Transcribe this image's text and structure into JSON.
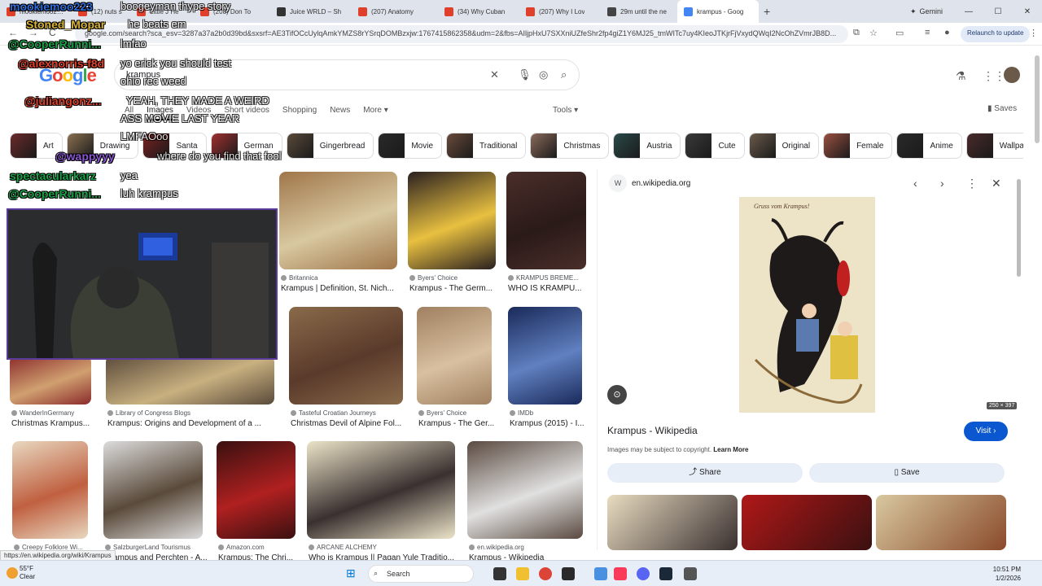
{
  "tabs": [
    {
      "title": "mookiemoo223 boogeyman thype story",
      "color": "#e0402a",
      "active": false,
      "w": 88
    },
    {
      "title": "(12) nuts s",
      "color": "#e0402a",
      "active": false,
      "w": 72
    },
    {
      "title": "Little J He",
      "color": "#e0402a",
      "active": false,
      "w": 78
    },
    {
      "title": "(208) Don To",
      "color": "#e0402a",
      "active": false,
      "w": 94
    },
    {
      "title": "Juice WRLD – Sh",
      "color": "#333333",
      "active": false,
      "w": 100
    },
    {
      "title": "(207) Anatomy",
      "color": "#e0402a",
      "active": false,
      "w": 106
    },
    {
      "title": "(34) Why Cuban",
      "color": "#e0402a",
      "active": false,
      "w": 100
    },
    {
      "title": "(207) Why I Lov",
      "color": "#e0402a",
      "active": false,
      "w": 100
    },
    {
      "title": "29m until the ne",
      "color": "#444444",
      "active": false,
      "w": 94
    },
    {
      "title": "krampus - Goog",
      "color": "#4285f4",
      "active": true,
      "w": 100
    }
  ],
  "browser": {
    "url": "google.com/search?sca_esv=3287a37a2b0d39bd&sxsrf=AE3TifOCcUylqAmkYMZS8rYSrqDOMBzxjw:1767415862358&udm=2&fbs=AIljpHxU7SXXniUZfeShr2fp4giZ1Y6MJ25_tmWITc7uy4KIeoJTKjrFjVxydQWqI2NcOhZVmrJB8D...",
    "relaunch": "Relaunch to update",
    "gemini": "Gemini",
    "back": "←",
    "forward": "→",
    "reload": "C"
  },
  "google": {
    "logo": "Google",
    "query": "krampus",
    "tabs": [
      "All",
      "Images",
      "Videos",
      "Short videos",
      "Shopping",
      "News",
      "More ▾"
    ],
    "active_tab": "Images",
    "tools": "Tools ▾",
    "saves": "Saves"
  },
  "chips": [
    {
      "label": "Art",
      "c": "#6b2a2a"
    },
    {
      "label": "Drawing",
      "c": "#8a7050"
    },
    {
      "label": "Santa",
      "c": "#7a2020"
    },
    {
      "label": "German",
      "c": "#a03030"
    },
    {
      "label": "Gingerbread",
      "c": "#5a4a3a"
    },
    {
      "label": "Movie",
      "c": "#2a2a2a"
    },
    {
      "label": "Traditional",
      "c": "#6a4a3a"
    },
    {
      "label": "Christmas",
      "c": "#8a6a5a"
    },
    {
      "label": "Austria",
      "c": "#2a4a4a"
    },
    {
      "label": "Cute",
      "c": "#3a3a3a"
    },
    {
      "label": "Original",
      "c": "#6a5a4a"
    },
    {
      "label": "Female",
      "c": "#9a5040"
    },
    {
      "label": "Anime",
      "c": "#2a2a2a"
    },
    {
      "label": "Wallpaper",
      "c": "#4a2a2a"
    }
  ],
  "results": [
    {
      "source": "Britannica",
      "title": "Krampus | Definition, St. Nich...",
      "c": "#a0764a",
      "c2": "#d8c8a0"
    },
    {
      "source": "Byers' Choice",
      "title": "Krampus - The Germ...",
      "c": "#2a2020",
      "c2": "#e8c040"
    },
    {
      "source": "KRAMPUS BREME...",
      "title": "WHO IS KRAMPU...",
      "c": "#4a2e2a",
      "c2": "#2a1a18"
    },
    {
      "source": "WanderInGermany",
      "title": "Christmas Krampus...",
      "c": "#8a2a2a",
      "c2": "#d0a070"
    },
    {
      "source": "Library of Congress Blogs",
      "title": "Krampus: Origins and Development of a ...",
      "c": "#5a4a3a",
      "c2": "#c8b080"
    },
    {
      "source": "Tasteful Croatian Journeys",
      "title": "Christmas Devil of Alpine Fol...",
      "c": "#8a6a4a",
      "c2": "#5a3a2a"
    },
    {
      "source": "Byers' Choice",
      "title": "Krampus - The Ger...",
      "c": "#a08060",
      "c2": "#d8c0a0"
    },
    {
      "source": "IMDb",
      "title": "Krampus (2015) - I...",
      "c": "#1a2a5a",
      "c2": "#6080c0"
    },
    {
      "source": "Creepy Folklore Wi...",
      "title": "Krampus...",
      "c": "#e8d8c0",
      "c2": "#c06040"
    },
    {
      "source": "SalzburgerLand Tourismus",
      "title": "Krampus and Perchten - A...",
      "c": "#dcdcdc",
      "c2": "#5a4a3a"
    },
    {
      "source": "Amazon.com",
      "title": "Krampus: The Chri...",
      "c": "#3a1010",
      "c2": "#b02020"
    },
    {
      "source": "ARCANE ALCHEMY",
      "title": "Who is Krampus || Pagan Yule Traditio...",
      "c": "#ece4c8",
      "c2": "#3a3030"
    },
    {
      "source": "en.wikipedia.org",
      "title": "Krampus - Wikipedia",
      "c": "#5a4a40",
      "c2": "#e0e0e0"
    }
  ],
  "panel": {
    "site": "en.wikipedia.org",
    "image_caption": "Gruss vom Krampus!",
    "dims": "250 × 397",
    "title": "Krampus - Wikipedia",
    "visit": "Visit",
    "copyright": "Images may be subject to copyright.",
    "learn_more": "Learn More",
    "share": "Share",
    "save": "Save"
  },
  "status_url": "https://en.wikipedia.org/wiki/Krampus",
  "taskbar": {
    "temp": "55°F",
    "weather": "Clear",
    "search": "Search",
    "time": "10:51 PM",
    "date": "1/2/2026"
  },
  "chat": [
    {
      "user": "mookiemoo223",
      "msg": "boogeyman thype story",
      "cls": "uBlue"
    },
    {
      "user": "Stoned_Mopar",
      "msg": "he beats em",
      "cls": "uYel"
    },
    {
      "user": "@CooperRunni...",
      "msg": "lmfao",
      "cls": "uGreen"
    },
    {
      "user": "@alexnorris-f8d",
      "msg": "yo erick you should test",
      "cls": "uRed"
    },
    {
      "user": "",
      "msg": "ohio rec weed",
      "cls": "uRed"
    },
    {
      "user": "@juliangonz...",
      "msg": "YEAH, THEY MADE A WEIRD",
      "cls": "uRed"
    },
    {
      "user": "",
      "msg": "ASS MOVIE LAST YEAR",
      "cls": "uRed"
    },
    {
      "user": "",
      "msg": "LMFAOoo",
      "cls": "uRed"
    },
    {
      "user": "@wappyyy",
      "msg": "where do you find that fool",
      "cls": "uPurple"
    },
    {
      "user": "spectacularkarz",
      "msg": "yea",
      "cls": "uGreen"
    },
    {
      "user": "@CooperRunni...",
      "msg": "luh krampus",
      "cls": "uGreen"
    }
  ]
}
